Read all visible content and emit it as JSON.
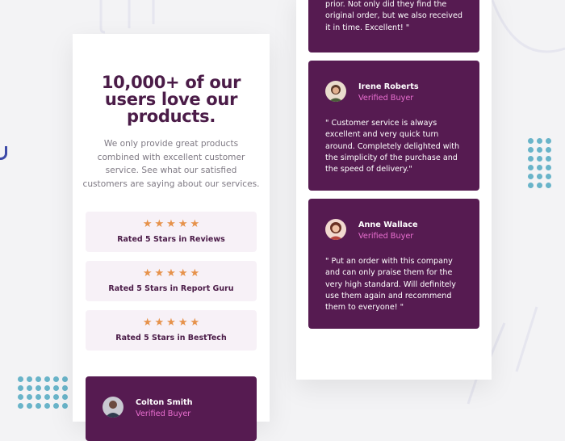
{
  "hero": {
    "title_line1": "10,000+ of our",
    "title_line2": "users love our",
    "title_line3": "products.",
    "description": "We only provide great products combined with excellent customer service. See what our satisfied customers are saying about our services."
  },
  "ratings": [
    {
      "stars": "★★★★★",
      "stars_value": 5,
      "label": "Rated 5 Stars in Reviews"
    },
    {
      "stars": "★★★★★",
      "stars_value": 5,
      "label": "Rated 5 Stars in Report Guru"
    },
    {
      "stars": "★★★★★",
      "stars_value": 5,
      "label": "Rated 5 Stars in BestTech"
    }
  ],
  "testimonials": [
    {
      "name": "",
      "status": "",
      "quote": "prior. Not only did they find the original order, but we also received it in time. Excellent! \""
    },
    {
      "name": "Irene Roberts",
      "status": "Verified Buyer",
      "quote": "\" Customer service is always excellent and very quick turn around. Completely delighted with the simplicity of the purchase and the speed of delivery.\""
    },
    {
      "name": "Anne Wallace",
      "status": "Verified Buyer",
      "quote": "\" Put an order with this company and can only praise them for the very high standard. Will definitely use them again and recommend them to everyone! \""
    },
    {
      "name": "Colton Smith",
      "status": "Verified Buyer",
      "quote": ""
    }
  ],
  "colors": {
    "dark_magenta": "#561b51",
    "title": "#4b1c48",
    "accent_pink": "#ea6fd1",
    "star": "#e6924b",
    "rating_bg": "#f7f1f7",
    "dots": "#69b4c9"
  }
}
